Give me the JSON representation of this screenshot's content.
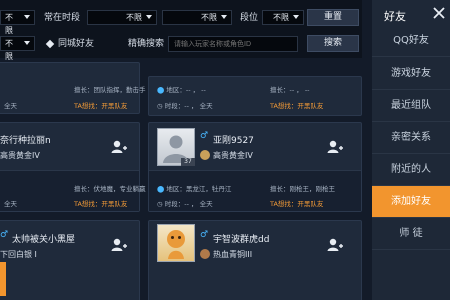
{
  "filters": {
    "row1_lead_value": "不限",
    "time_label": "常在时段",
    "time_value": "不限",
    "time_value2": "不限",
    "tier_label": "段位",
    "tier_value": "不限",
    "reset_label": "重置",
    "row2_lead_value": "不限",
    "same_city_label": "同城好友",
    "search_label": "精确搜索",
    "search_placeholder": "请输入玩家名称或角色ID",
    "search_button": "搜索"
  },
  "cards": [
    {
      "slogan_label": "擅长：",
      "slogan_value": "团队指挥，勤击手",
      "time_prefix": "全天",
      "ta_label": "TA想找：",
      "ta_value": "开黑队友"
    },
    {
      "region_label": "地区：",
      "region_value": "-- ， --",
      "duty_label": "擅长：",
      "duty_value": "-- ， --",
      "time_label": "时段：",
      "time_value": "-- ， 全天",
      "ta_label": "TA想找：",
      "ta_value": "开黑队友"
    },
    {
      "name": "奈行种拉丽n",
      "rank": "高贵黄金IV",
      "slogan_label": "擅长：",
      "slogan_value": "伏地魔，专业躺赢",
      "time_prefix": "全天",
      "ta_label": "TA想找：",
      "ta_value": "开黑队友"
    },
    {
      "name": "亚刚9527",
      "rank": "高贵黄金IV",
      "level": "37",
      "region_label": "地区：",
      "region_value": "黑龙江，牡丹江",
      "duty_label": "擅长：",
      "duty_value": "刚枪王，刚枪王",
      "time_label": "时段：",
      "time_value": "-- ， 全天",
      "ta_label": "TA想找：",
      "ta_value": "开黑队友"
    },
    {
      "name": "太帅被关小黑屋",
      "rank": "下回白银 I"
    },
    {
      "name": "宇智波群虎dd",
      "rank": "热血青铜III"
    }
  ],
  "sidebar": {
    "title": "好友",
    "items": [
      "QQ好友",
      "游戏好友",
      "最近组队",
      "亲密关系",
      "附近的人",
      "添加好友",
      "师 徒"
    ],
    "active_index": 5
  },
  "colors": {
    "accent": "#f2952e",
    "male_icon": "#49b8ff",
    "orange_text": "#f29a37"
  }
}
